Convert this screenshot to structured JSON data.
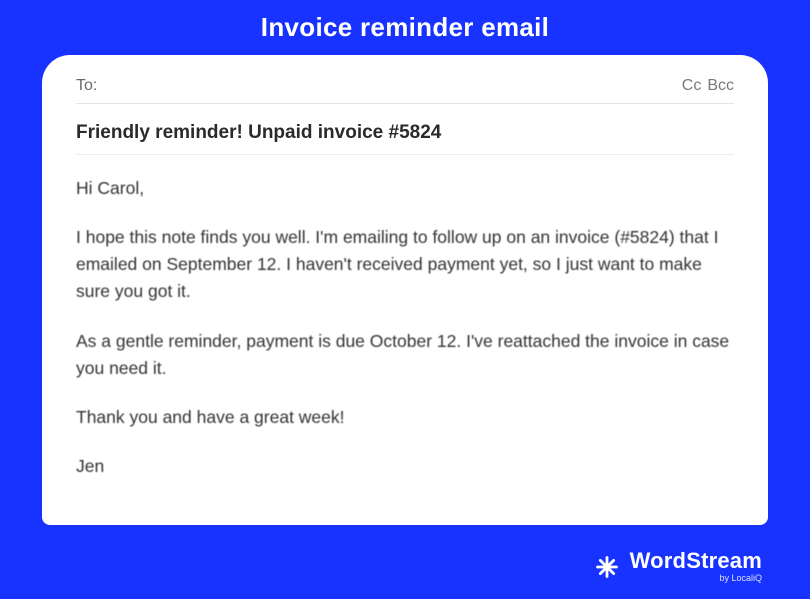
{
  "page": {
    "title": "Invoice reminder email"
  },
  "email": {
    "toLabel": "To:",
    "ccLabel": "Cc",
    "bccLabel": "Bcc",
    "subject": "Friendly reminder! Unpaid invoice #5824",
    "body": {
      "greeting": "Hi Carol,",
      "para1": "I hope this note finds you well. I'm emailing to follow up on an invoice (#5824) that I emailed on September 12. I haven't received  payment yet, so I just want to make sure you got it.",
      "para2": "As a gentle reminder, payment is due October 12. I've reattached the invoice in case you need it.",
      "para3": "Thank you and have a great week!",
      "signoff": "Jen"
    }
  },
  "brand": {
    "name": "WordStream",
    "byline": "by LocaliQ"
  }
}
